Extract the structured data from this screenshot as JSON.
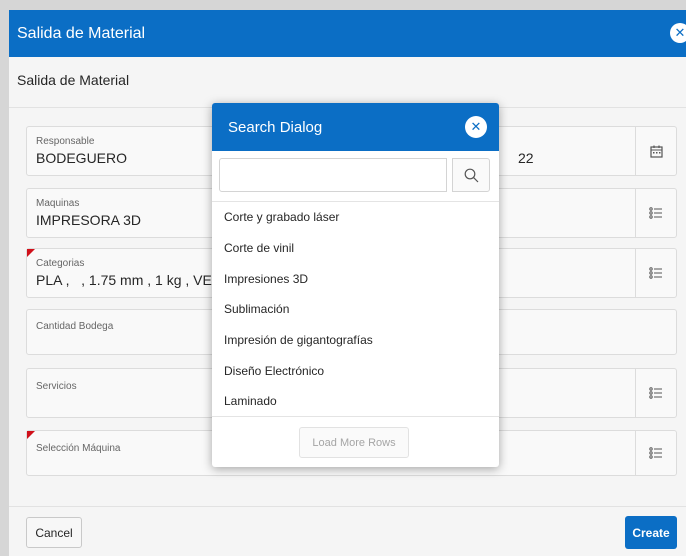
{
  "modal": {
    "title": "Salida de Material",
    "close_icon": "close-icon",
    "region_title": "Salida de Material"
  },
  "fields": {
    "responsable": {
      "label": "Responsable",
      "value": "BODEGUERO",
      "partial_value": "22",
      "icon": "calendar-icon"
    },
    "maquinas": {
      "label": "Maquinas",
      "value": "IMPRESORA 3D",
      "icon": "list-icon"
    },
    "categorias": {
      "label": "Categorias",
      "value": "PLA ,   , 1.75 mm , 1 kg , VERD",
      "icon": "list-icon",
      "required": true
    },
    "cantidad_bodega": {
      "label": "Cantidad Bodega",
      "value": ""
    },
    "servicios": {
      "label": "Servicios",
      "value": "",
      "icon": "list-icon"
    },
    "seleccion_maquina": {
      "label": "Selección Máquina",
      "value": "",
      "icon": "list-icon",
      "required": true
    }
  },
  "buttons": {
    "cancel": "Cancel",
    "create": "Create"
  },
  "search_dialog": {
    "title": "Search Dialog",
    "search_value": "",
    "search_placeholder": "",
    "items": [
      "Corte y grabado láser",
      "Corte de vinil",
      "Impresiones 3D",
      "Sublimación",
      "Impresión de gigantografías",
      "Diseño Electrónico",
      "Laminado"
    ],
    "load_more": "Load More Rows"
  },
  "colors": {
    "brand": "#0b6ec5",
    "required": "#d0101a"
  }
}
